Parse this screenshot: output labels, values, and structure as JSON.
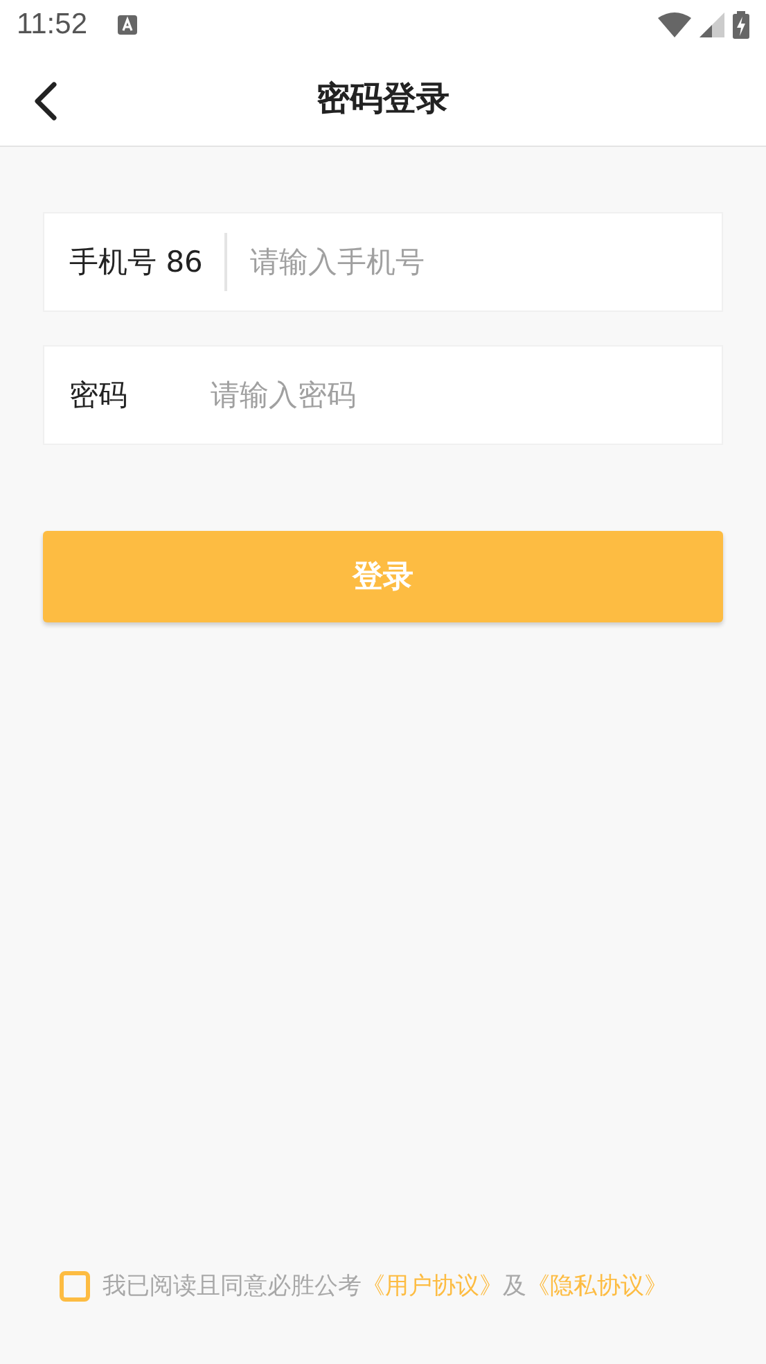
{
  "status_bar": {
    "time": "11:52"
  },
  "header": {
    "title": "密码登录"
  },
  "fields": [
    {
      "kind": "phone",
      "label": "手机号",
      "code": "86",
      "placeholder": "请输入手机号"
    },
    {
      "kind": "password",
      "label": "密码",
      "placeholder": "请输入密码"
    }
  ],
  "login_button": "登录",
  "agreement": {
    "checked": false,
    "parts": [
      {
        "kind": "text",
        "text": "我已阅读且同意必胜公考"
      },
      {
        "kind": "link",
        "text": "《用户协议》"
      },
      {
        "kind": "text",
        "text": "及"
      },
      {
        "kind": "link",
        "text": "《隐私协议》"
      }
    ]
  }
}
